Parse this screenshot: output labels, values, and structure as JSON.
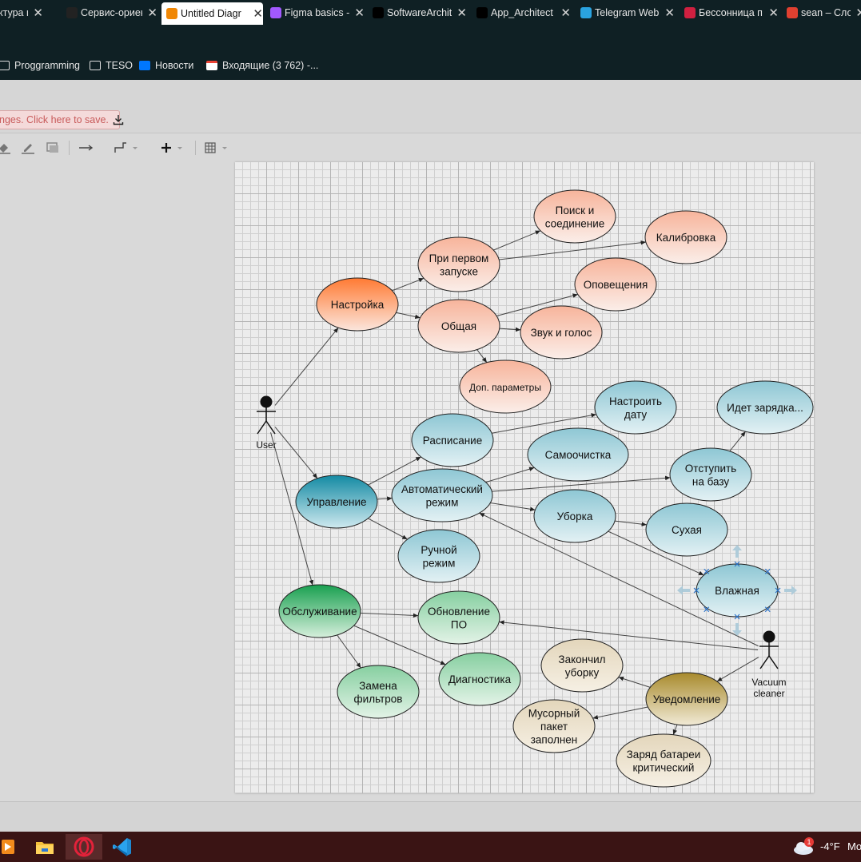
{
  "browser": {
    "tabs": [
      {
        "title": "ктура пр",
        "icon_name": "page-icon",
        "active": false
      },
      {
        "title": "Сервис-ориен",
        "icon_name": "openai-icon",
        "active": false
      },
      {
        "title": "Untitled Diagr",
        "icon_name": "drawio-icon",
        "active": true
      },
      {
        "title": "Figma basics -",
        "icon_name": "figma-icon",
        "active": false
      },
      {
        "title": "SoftwareArchit",
        "icon_name": "github-icon",
        "active": false
      },
      {
        "title": "App_Architect",
        "icon_name": "github-icon",
        "active": false
      },
      {
        "title": "Telegram Web",
        "icon_name": "telegram-icon",
        "active": false
      },
      {
        "title": "Бессонница п",
        "icon_name": "music-icon",
        "active": false
      },
      {
        "title": "sean – Словар",
        "icon_name": "dictionary-icon",
        "active": false
      }
    ],
    "bookmarks": [
      {
        "label": "Proggramming",
        "icon_name": "folder-icon"
      },
      {
        "label": "TESO",
        "icon_name": "folder-icon"
      },
      {
        "label": "Новости",
        "icon_name": "vk-icon"
      },
      {
        "label": "Входящие (3 762) -...",
        "icon_name": "gmail-icon"
      }
    ]
  },
  "app": {
    "save_banner": "nges. Click here to save.",
    "toolbar_icons": [
      "fill-color-icon",
      "line-color-icon",
      "shadow-icon",
      "connection-arrow-icon",
      "waypoint-icon",
      "insert-plus-icon",
      "table-icon"
    ]
  },
  "diagram": {
    "actors": [
      {
        "id": "user",
        "label": "User"
      },
      {
        "id": "vacuum",
        "label": "Vacuum\ncleaner"
      }
    ],
    "use_cases": [
      {
        "id": "nastroika",
        "label": "Настройка",
        "group": "orange-dark"
      },
      {
        "id": "pervyi",
        "label": "При первом\nзапуске",
        "group": "orange"
      },
      {
        "id": "poisk",
        "label": "Поиск и\nсоединение",
        "group": "orange"
      },
      {
        "id": "kalibr",
        "label": "Калибровка",
        "group": "orange"
      },
      {
        "id": "obshaya",
        "label": "Общая",
        "group": "orange"
      },
      {
        "id": "opov",
        "label": "Оповещения",
        "group": "orange"
      },
      {
        "id": "zvuk",
        "label": "Звук и голос",
        "group": "orange"
      },
      {
        "id": "dop",
        "label": "Доп. параметры",
        "group": "orange"
      },
      {
        "id": "upravl",
        "label": "Управление",
        "group": "teal-dark"
      },
      {
        "id": "raspis",
        "label": "Расписание",
        "group": "teal"
      },
      {
        "id": "nastrdata",
        "label": "Настроить\nдату",
        "group": "teal"
      },
      {
        "id": "zaryadka",
        "label": "Идет зарядка...",
        "group": "teal"
      },
      {
        "id": "samoch",
        "label": "Самоочистка",
        "group": "teal"
      },
      {
        "id": "avto",
        "label": "Автоматический\nрежим",
        "group": "teal"
      },
      {
        "id": "otstup",
        "label": "Отступить\nна базу",
        "group": "teal"
      },
      {
        "id": "uborka",
        "label": "Уборка",
        "group": "teal"
      },
      {
        "id": "suhaya",
        "label": "Сухая",
        "group": "teal"
      },
      {
        "id": "ruchnoi",
        "label": "Ручной\nрежим",
        "group": "teal"
      },
      {
        "id": "vlazh",
        "label": "Влажная",
        "group": "teal"
      },
      {
        "id": "obsl",
        "label": "Обслуживание",
        "group": "green-dark"
      },
      {
        "id": "obnov",
        "label": "Обновление\nПО",
        "group": "green"
      },
      {
        "id": "diag",
        "label": "Диагностика",
        "group": "green"
      },
      {
        "id": "zamena",
        "label": "Замена\nфильтров",
        "group": "green"
      },
      {
        "id": "uvedoml",
        "label": "Уведомление",
        "group": "gold-dark"
      },
      {
        "id": "zakonchil",
        "label": "Закончил\nуборку",
        "group": "beige"
      },
      {
        "id": "musor",
        "label": "Мусорный\nпакет\nзаполнен",
        "group": "beige"
      },
      {
        "id": "zaryad",
        "label": "Заряд батареи\nкритический",
        "group": "beige"
      }
    ],
    "edges": [
      [
        "user",
        "nastroika"
      ],
      [
        "user",
        "upravl"
      ],
      [
        "user",
        "obsl"
      ],
      [
        "nastroika",
        "pervyi"
      ],
      [
        "nastroika",
        "obshaya"
      ],
      [
        "pervyi",
        "poisk"
      ],
      [
        "pervyi",
        "kalibr"
      ],
      [
        "obshaya",
        "opov"
      ],
      [
        "obshaya",
        "zvuk"
      ],
      [
        "obshaya",
        "dop"
      ],
      [
        "upravl",
        "raspis"
      ],
      [
        "upravl",
        "avto"
      ],
      [
        "upravl",
        "ruchnoi"
      ],
      [
        "raspis",
        "nastrdata"
      ],
      [
        "avto",
        "samoch"
      ],
      [
        "avto",
        "otstup"
      ],
      [
        "avto",
        "uborka"
      ],
      [
        "otstup",
        "zaryadka"
      ],
      [
        "uborka",
        "suhaya"
      ],
      [
        "uborka",
        "vlazh"
      ],
      [
        "obsl",
        "obnov"
      ],
      [
        "obsl",
        "diag"
      ],
      [
        "obsl",
        "zamena"
      ],
      [
        "vacuum",
        "avto"
      ],
      [
        "vacuum",
        "obnov"
      ],
      [
        "vacuum",
        "uvedoml"
      ],
      [
        "uvedoml",
        "zakonchil"
      ],
      [
        "uvedoml",
        "musor"
      ],
      [
        "uvedoml",
        "zaryad"
      ]
    ],
    "colors": {
      "orange-dark": [
        "#ff7a33",
        "#fbe6dd"
      ],
      "orange": [
        "#f7b49b",
        "#fbeee9"
      ],
      "teal-dark": [
        "#138aa3",
        "#cfe9ef"
      ],
      "teal": [
        "#8ec7d4",
        "#e3f1f4"
      ],
      "green-dark": [
        "#19a050",
        "#d6efdc"
      ],
      "green": [
        "#86cfa0",
        "#e3f3e7"
      ],
      "gold-dark": [
        "#a88a2c",
        "#f1ead6"
      ],
      "beige": [
        "#e3d6bb",
        "#f6f0e4"
      ]
    }
  },
  "taskbar": {
    "icons": [
      "media-player-icon",
      "file-explorer-icon",
      "opera-icon",
      "vscode-icon"
    ],
    "weather_badge": "1",
    "temperature": "-4°F",
    "overflow_text": "Mo"
  }
}
